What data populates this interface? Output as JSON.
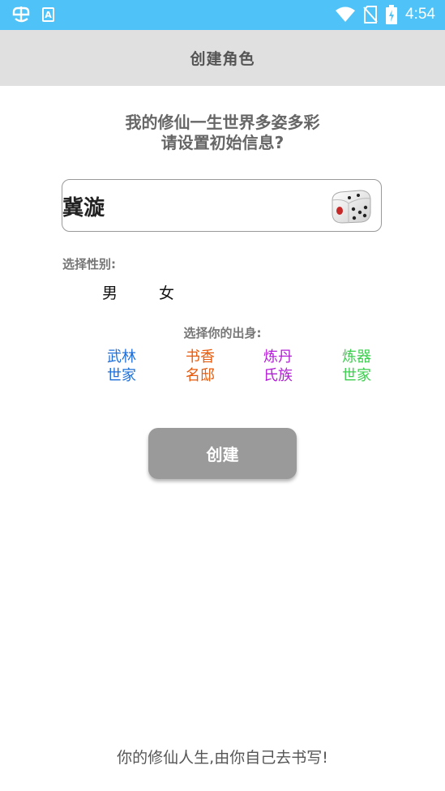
{
  "status_bar": {
    "time": "4:54",
    "icons": [
      "app-logo-icon",
      "app-store-icon",
      "wifi-icon",
      "no-sim-icon",
      "battery-charging-icon"
    ]
  },
  "app_bar": {
    "title": "创建角色"
  },
  "intro": {
    "line1": "我的修仙一生世界多姿多彩",
    "line2": "请设置初始信息?"
  },
  "name_field": {
    "value": "冀漩",
    "dice_icon": "dice-icon"
  },
  "gender": {
    "label": "选择性别:",
    "options": [
      {
        "label": "男"
      },
      {
        "label": "女"
      }
    ]
  },
  "origin": {
    "label": "选择你的出身:",
    "options": [
      {
        "line1": "武林",
        "line2": "世家",
        "color": "#1e6fd9"
      },
      {
        "line1": "书香",
        "line2": "名邸",
        "color": "#e65a0c"
      },
      {
        "line1": "炼丹",
        "line2": "氏族",
        "color": "#b21fd6"
      },
      {
        "line1": "炼器",
        "line2": "世家",
        "color": "#3ccf4e"
      }
    ]
  },
  "create_button": {
    "label": "创建"
  },
  "footer": {
    "text": "你的修仙人生,由你自己去书写!"
  }
}
